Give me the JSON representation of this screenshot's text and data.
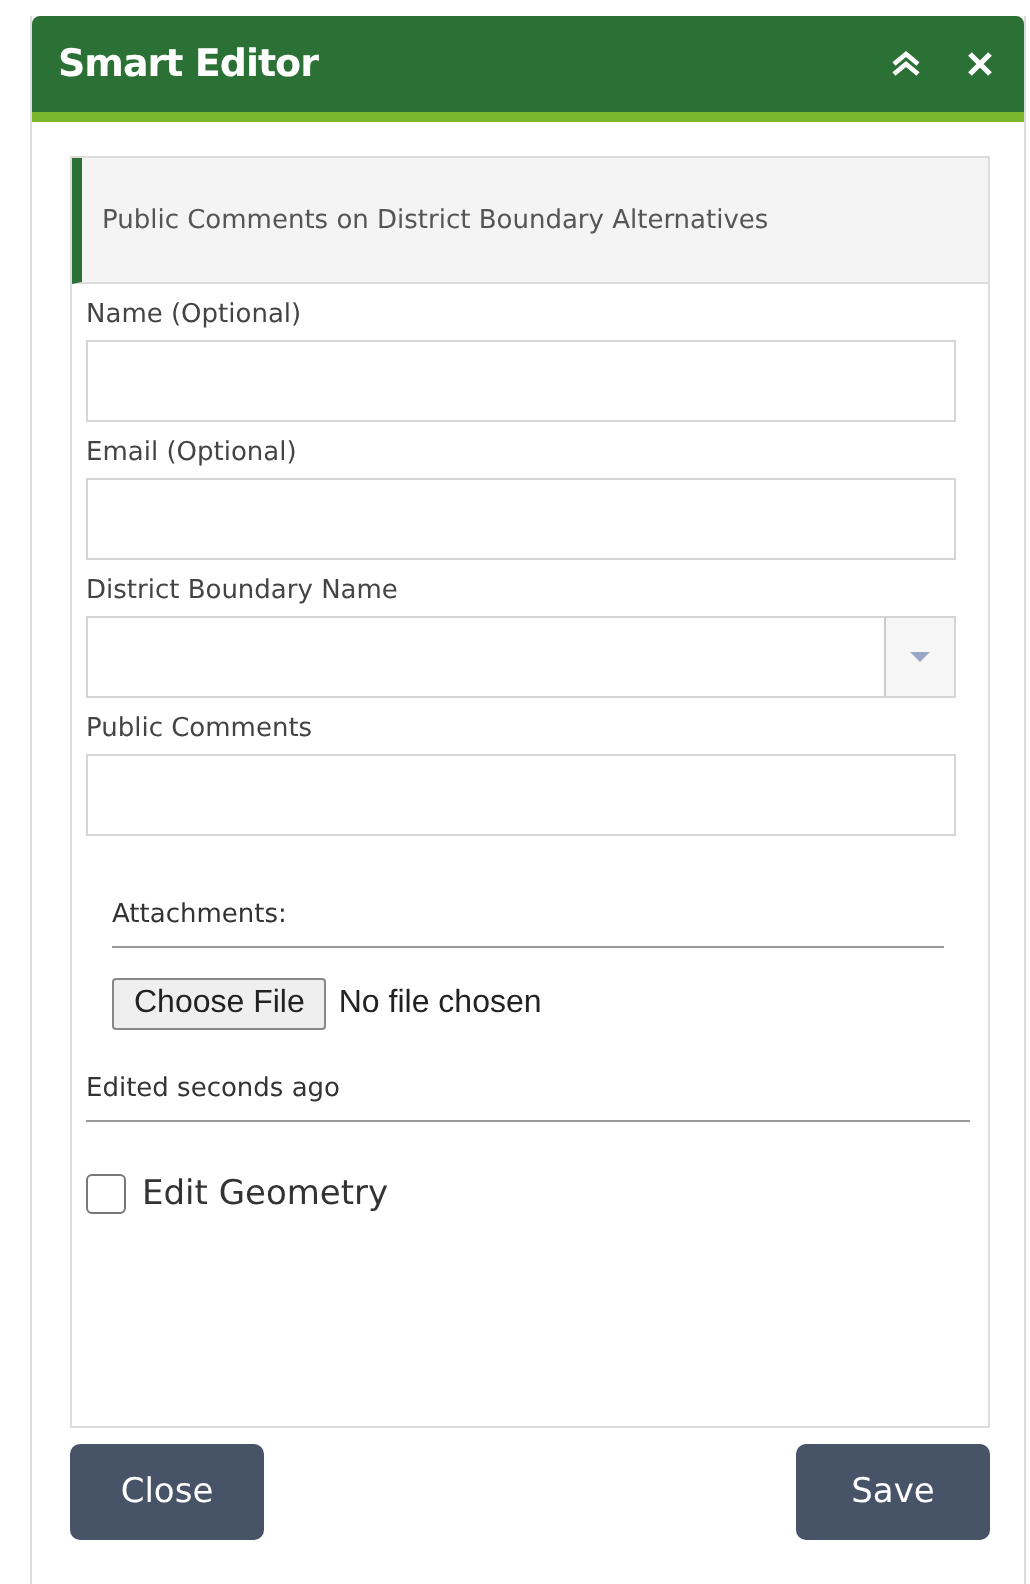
{
  "window": {
    "title": "Smart Editor"
  },
  "layer_title": "Public Comments on District Boundary Alternatives",
  "fields": [
    {
      "label": "Name (Optional)",
      "kind": "text"
    },
    {
      "label": "Email (Optional)",
      "kind": "text"
    },
    {
      "label": "District Boundary Name",
      "kind": "select"
    },
    {
      "label": "Public Comments",
      "kind": "text"
    }
  ],
  "attachments": {
    "label": "Attachments:",
    "button": "Choose File",
    "status": "No file chosen"
  },
  "edited": "Edited seconds ago",
  "edit_geometry": {
    "label": "Edit Geometry",
    "checked": false
  },
  "buttons": [
    "Close",
    "Save"
  ]
}
